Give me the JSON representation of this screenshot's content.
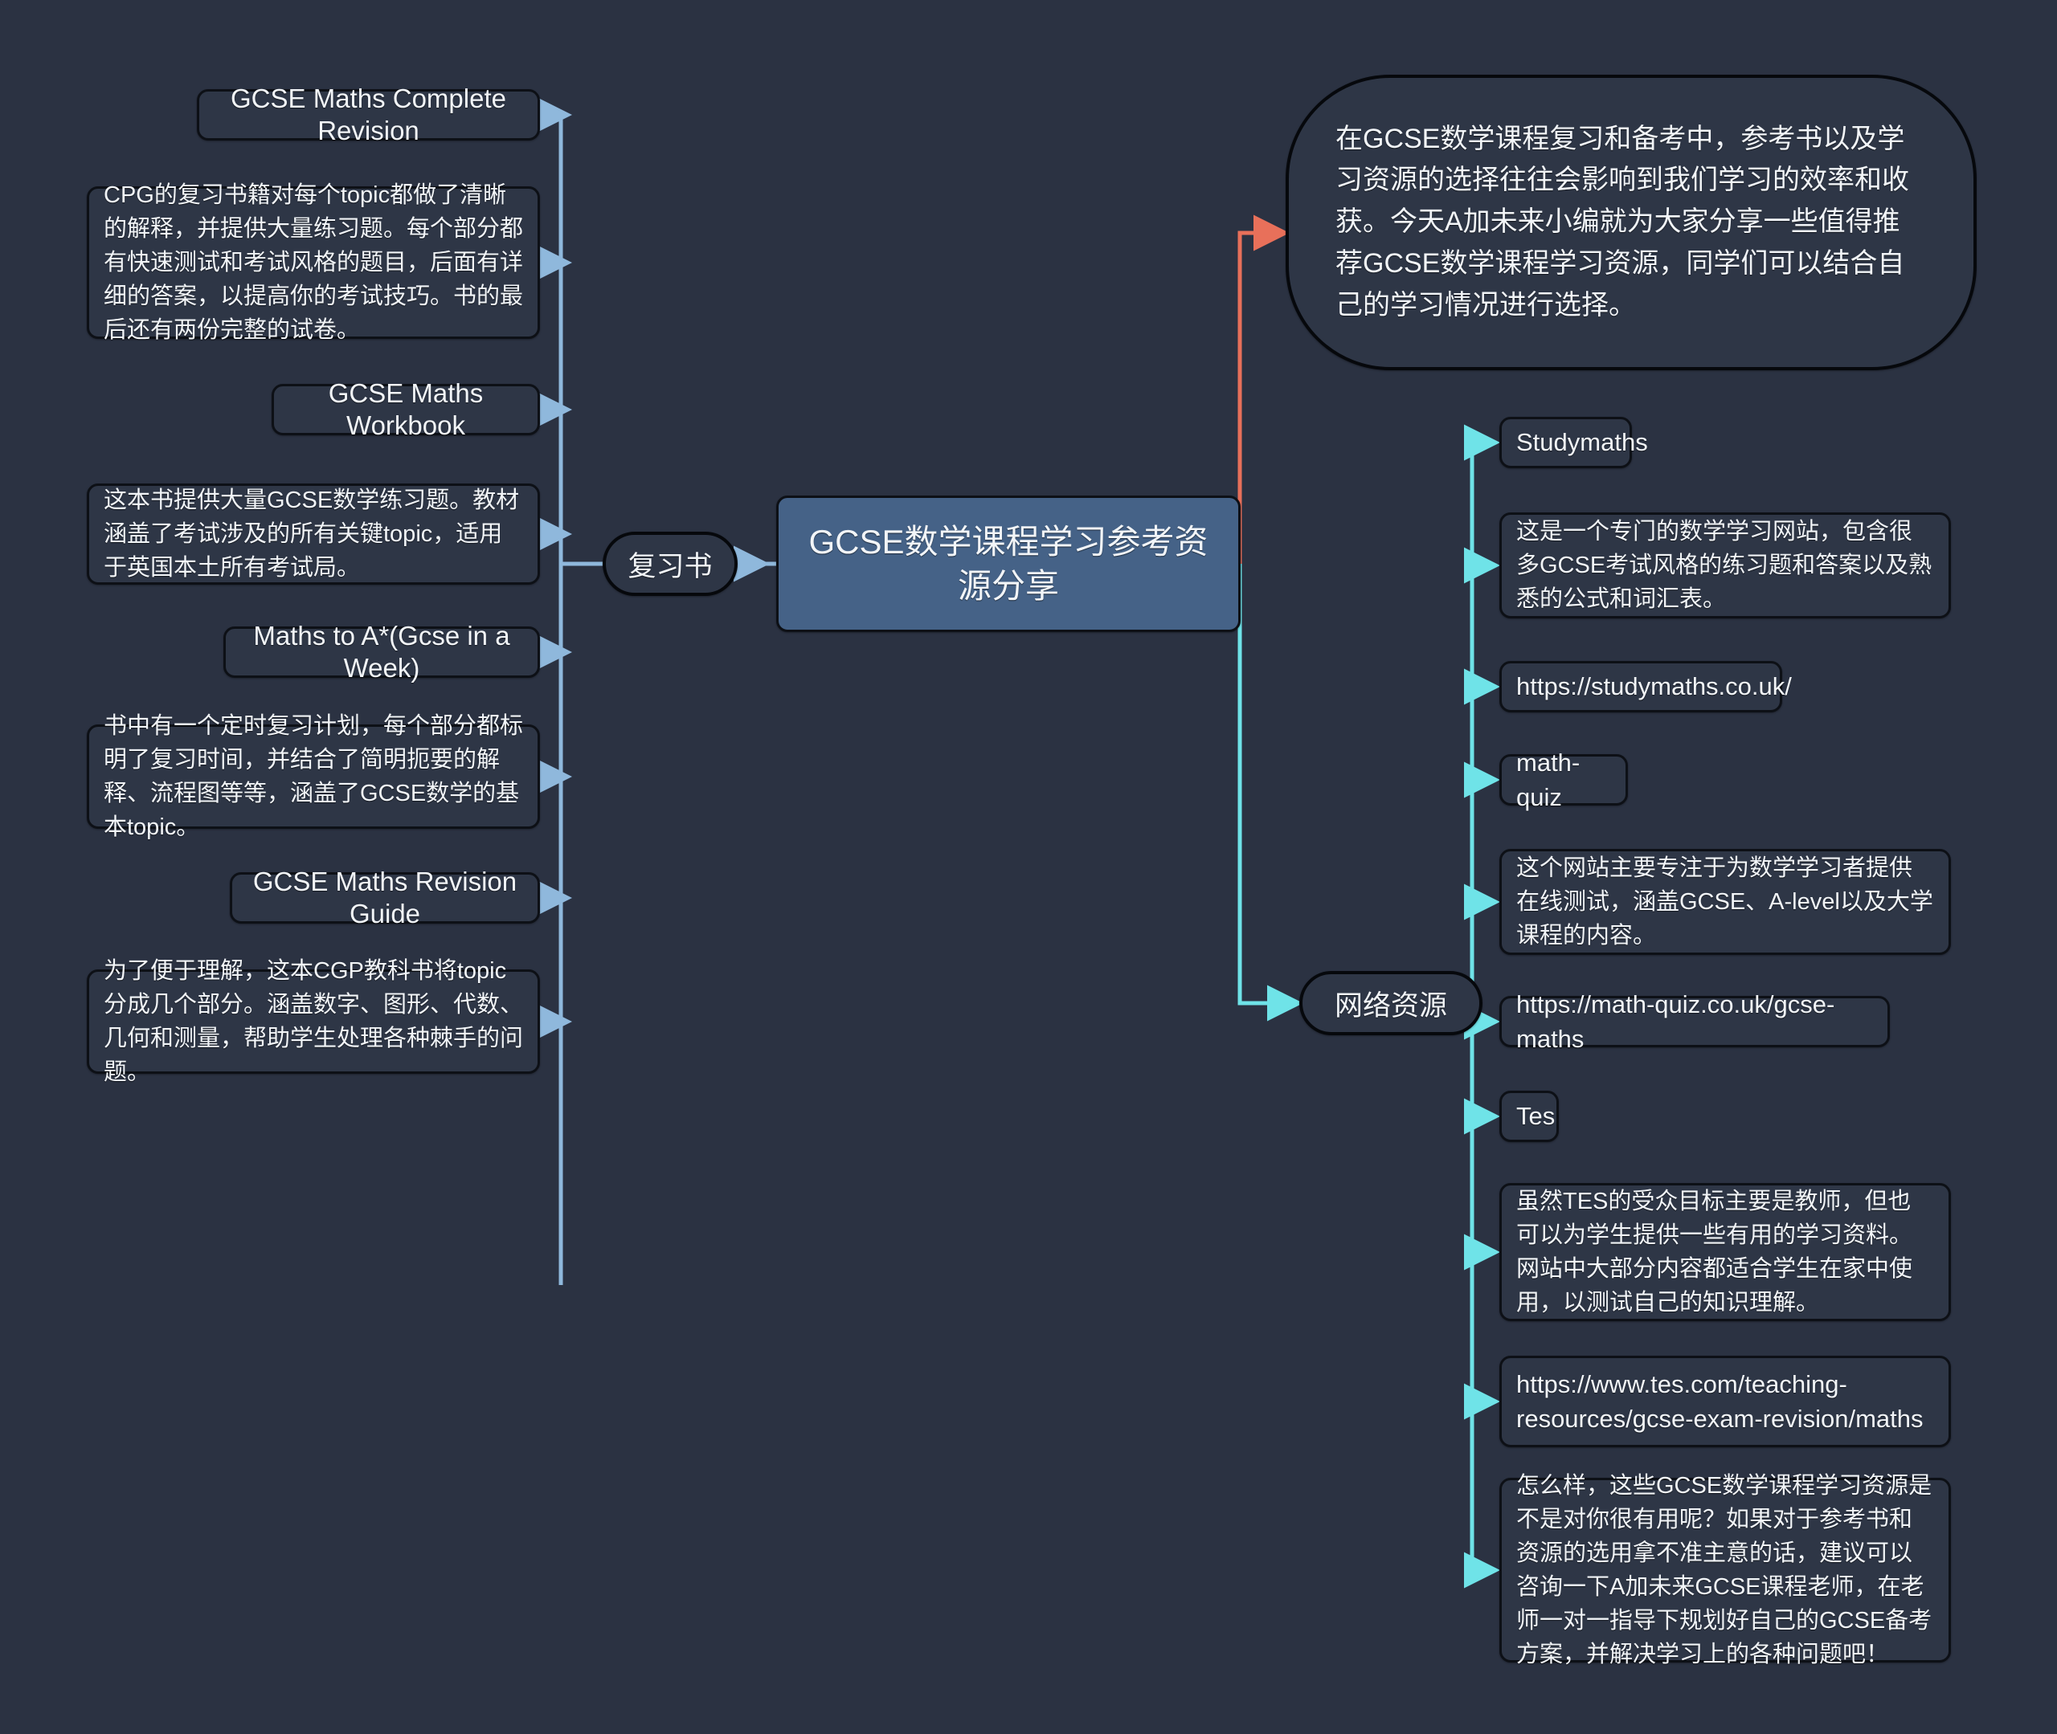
{
  "theme": {
    "background": "#2b3242",
    "node_fill": "#2e3646",
    "node_border": "#0d1016",
    "root_fill": "#456287",
    "text_color": "#f2f5f8",
    "edge_left_color": "#8fb8dc",
    "edge_right_color": "#6fe3e8",
    "edge_intro_color": "#e8705a"
  },
  "root": {
    "label": "GCSE数学课程学习参考资源分享"
  },
  "intro": {
    "label": "在GCSE数学课程复习和备考中，参考书以及学习资源的选择往往会影响到我们学习的效率和收获。今天A加未来小编就为大家分享一些值得推荐GCSE数学课程学习资源，同学们可以结合自己的学习情况进行选择。"
  },
  "branches": [
    {
      "id": "revision-books",
      "label": "复习书",
      "side": "left",
      "items": [
        {
          "id": "gcse-maths-complete-revision",
          "type": "title",
          "label": "GCSE Maths Complete Revision"
        },
        {
          "id": "gcse-maths-complete-revision-desc",
          "type": "paragraph",
          "label": "CPG的复习书籍对每个topic都做了清晰的解释，并提供大量练习题。每个部分都有快速测试和考试风格的题目，后面有详细的答案，以提高你的考试技巧。书的最后还有两份完整的试卷。"
        },
        {
          "id": "gcse-maths-workbook",
          "type": "title",
          "label": "GCSE Maths Workbook"
        },
        {
          "id": "gcse-maths-workbook-desc",
          "type": "paragraph",
          "label": "这本书提供大量GCSE数学练习题。教材涵盖了考试涉及的所有关键topic，适用于英国本土所有考试局。"
        },
        {
          "id": "maths-to-a-star",
          "type": "title",
          "label": "Maths to A*(Gcse in a Week)"
        },
        {
          "id": "maths-to-a-star-desc",
          "type": "paragraph",
          "label": "书中有一个定时复习计划，每个部分都标明了复习时间，并结合了简明扼要的解释、流程图等等，涵盖了GCSE数学的基本topic。"
        },
        {
          "id": "gcse-maths-revision-guide",
          "type": "title",
          "label": "GCSE Maths Revision Guide"
        },
        {
          "id": "gcse-maths-revision-guide-desc",
          "type": "paragraph",
          "label": "为了便于理解，这本CGP教科书将topic分成几个部分。涵盖数字、图形、代数、几何和测量，帮助学生处理各种棘手的问题。"
        }
      ]
    },
    {
      "id": "web-resources",
      "label": "网络资源",
      "side": "right",
      "items": [
        {
          "id": "studymaths",
          "type": "plain",
          "label": "Studymaths"
        },
        {
          "id": "studymaths-desc",
          "type": "paragraph",
          "label": "这是一个专门的数学学习网站，包含很多GCSE考试风格的练习题和答案以及熟悉的公式和词汇表。"
        },
        {
          "id": "studymaths-url",
          "type": "plain",
          "label": "https://studymaths.co.uk/"
        },
        {
          "id": "math-quiz",
          "type": "plain",
          "label": "math-quiz"
        },
        {
          "id": "math-quiz-desc",
          "type": "paragraph",
          "label": "这个网站主要专注于为数学学习者提供在线测试，涵盖GCSE、A-level以及大学课程的内容。"
        },
        {
          "id": "math-quiz-url",
          "type": "plain",
          "label": "https://math-quiz.co.uk/gcse-maths"
        },
        {
          "id": "tes",
          "type": "plain",
          "label": "Tes"
        },
        {
          "id": "tes-desc",
          "type": "paragraph",
          "label": "虽然TES的受众目标主要是教师，但也可以为学生提供一些有用的学习资料。网站中大部分内容都适合学生在家中使用，以测试自己的知识理解。"
        },
        {
          "id": "tes-url",
          "type": "plain",
          "label": "https://www.tes.com/teaching-resources/gcse-exam-revision/maths"
        },
        {
          "id": "conclusion",
          "type": "paragraph",
          "label": "怎么样，这些GCSE数学课程学习资源是不是对你很有用呢？如果对于参考书和资源的选用拿不准主意的话，建议可以咨询一下A加未来GCSE课程老师，在老师一对一指导下规划好自己的GCSE备考方案，并解决学习上的各种问题吧！"
        }
      ]
    }
  ]
}
